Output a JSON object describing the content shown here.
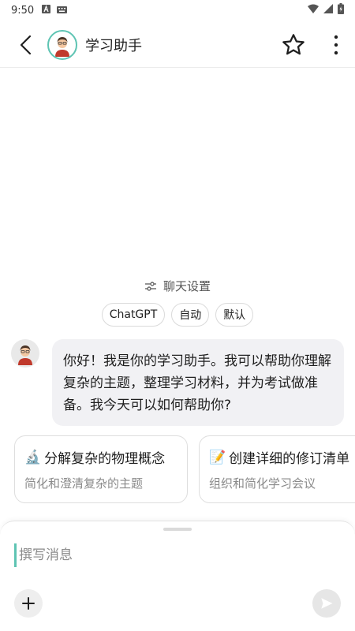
{
  "status_bar": {
    "time": "9:50"
  },
  "header": {
    "title": "学习助手",
    "back_icon": "back-arrow-icon",
    "favorite_icon": "star-outline-icon",
    "more_icon": "more-vert-icon"
  },
  "chat_settings": {
    "label": "聊天设置",
    "icon": "sliders-icon"
  },
  "chips": [
    "ChatGPT",
    "自动",
    "默认"
  ],
  "message": {
    "text": "你好！我是你的学习助手。我可以帮助你理解复杂的主题，整理学习材料，并为考试做准备。我今天可以如何帮助你?"
  },
  "suggestions": [
    {
      "emoji": "🔬",
      "title": "分解复杂的物理概念",
      "subtitle": "简化和澄清复杂的主题"
    },
    {
      "emoji": "📝",
      "title": "创建详细的修订清单",
      "subtitle": "组织和简化学习会议"
    }
  ],
  "composer": {
    "placeholder": "撰写消息"
  },
  "colors": {
    "accent": "#5ec4b3",
    "bubble": "#f1f1f4"
  }
}
